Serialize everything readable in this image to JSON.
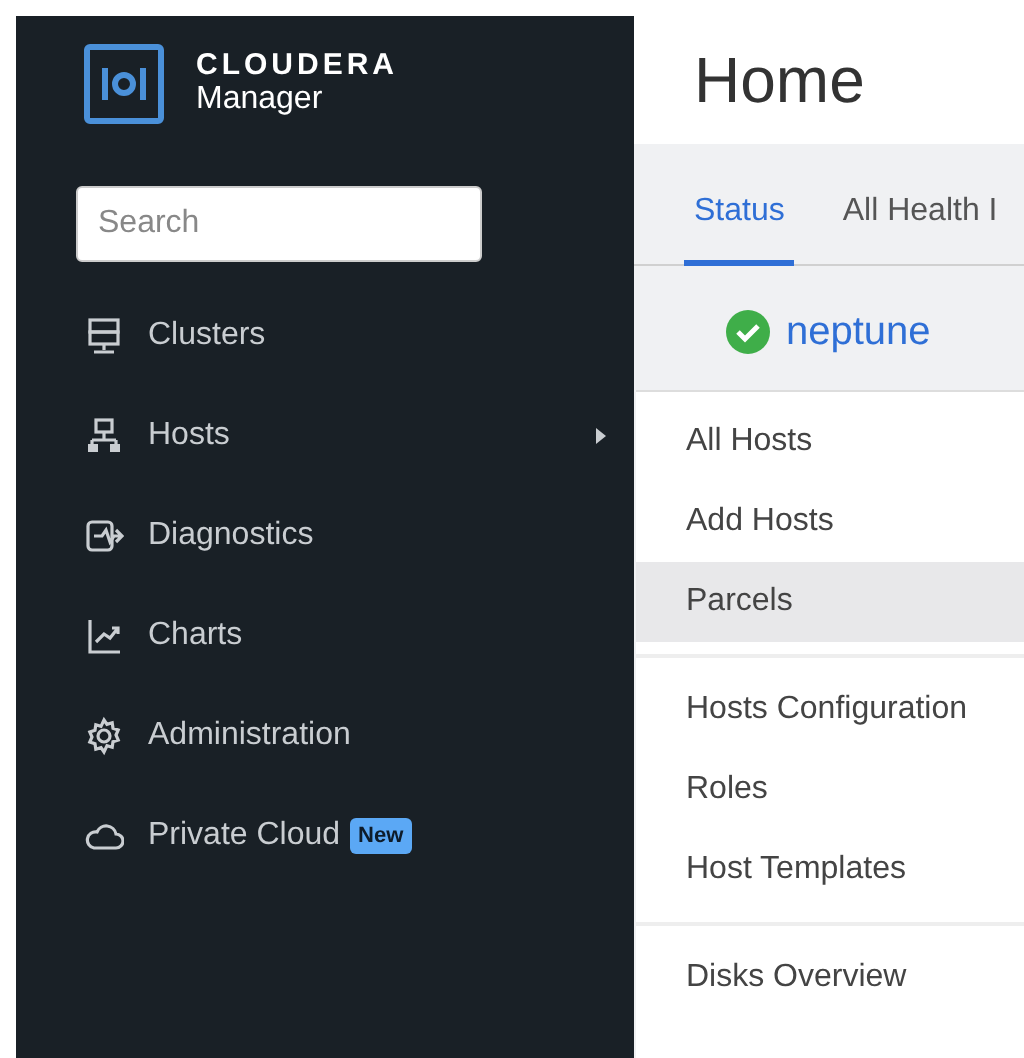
{
  "sidebar": {
    "logo": {
      "brand": "CLOUDERA",
      "product": "Manager"
    },
    "search": {
      "placeholder": "Search"
    },
    "items": [
      {
        "label": "Clusters",
        "kind": "server",
        "submenu": false
      },
      {
        "label": "Hosts",
        "kind": "network",
        "submenu": true
      },
      {
        "label": "Diagnostics",
        "kind": "diagnostics",
        "submenu": false
      },
      {
        "label": "Charts",
        "kind": "chart",
        "submenu": false
      },
      {
        "label": "Administration",
        "kind": "gear",
        "submenu": false
      },
      {
        "label": "Private Cloud",
        "kind": "cloud",
        "submenu": false,
        "badge": "New"
      }
    ]
  },
  "main": {
    "title": "Home",
    "tabs": [
      {
        "label": "Status",
        "selected": true
      },
      {
        "label": "All Health I",
        "selected": false
      }
    ],
    "cluster": {
      "name": "neptune"
    }
  },
  "hosts_menu": [
    {
      "kind": "item",
      "label": "All Hosts",
      "selected": false
    },
    {
      "kind": "item",
      "label": "Add Hosts",
      "selected": false
    },
    {
      "kind": "item",
      "label": "Parcels",
      "selected": true
    },
    {
      "kind": "divider"
    },
    {
      "kind": "item",
      "label": "Hosts Configuration",
      "selected": false
    },
    {
      "kind": "item",
      "label": "Roles",
      "selected": false
    },
    {
      "kind": "item",
      "label": "Host Templates",
      "selected": false
    },
    {
      "kind": "divider"
    },
    {
      "kind": "item",
      "label": "Disks Overview",
      "selected": false
    }
  ]
}
